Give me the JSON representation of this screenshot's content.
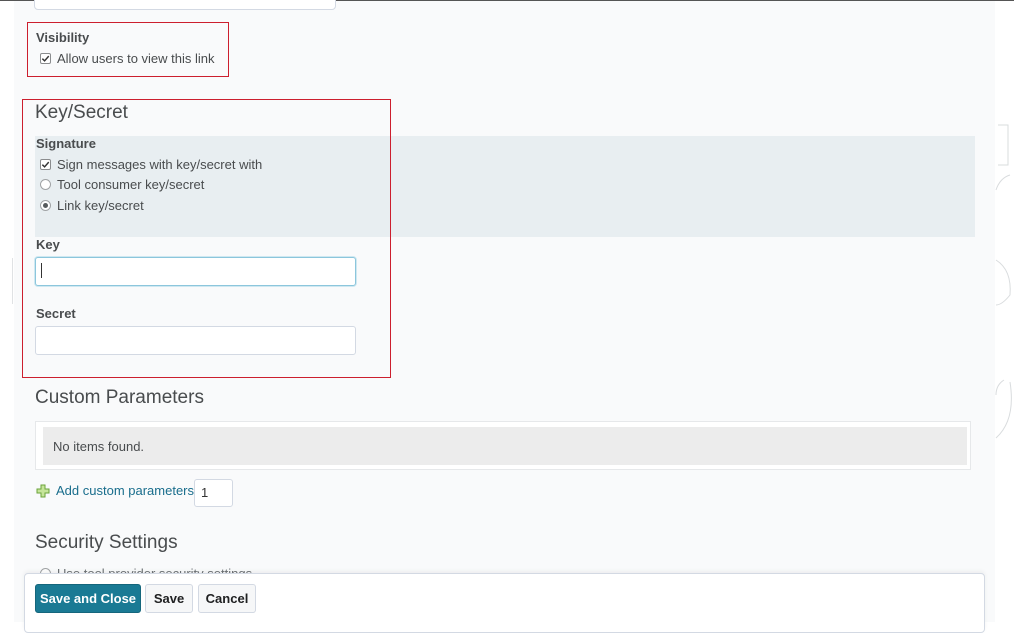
{
  "visibility": {
    "label": "Visibility",
    "checkbox_label": "Allow users to view this link",
    "checked": true
  },
  "key_secret": {
    "title": "Key/Secret",
    "signature": {
      "label": "Signature",
      "sign_checkbox_label": "Sign messages with key/secret with",
      "sign_checked": true,
      "options": [
        {
          "label": "Tool consumer key/secret",
          "selected": false
        },
        {
          "label": "Link key/secret",
          "selected": true
        }
      ]
    },
    "key": {
      "label": "Key",
      "value": ""
    },
    "secret": {
      "label": "Secret",
      "value": ""
    }
  },
  "custom_parameters": {
    "title": "Custom Parameters",
    "empty_text": "No items found.",
    "add_label": "Add custom parameters",
    "add_count": "1"
  },
  "security_settings": {
    "title": "Security Settings",
    "first_option": "Use tool provider security settings"
  },
  "footer": {
    "save_close_label": "Save and Close",
    "save_label": "Save",
    "cancel_label": "Cancel"
  },
  "colors": {
    "accent": "#1a7a94",
    "highlight_box": "#cc1f2e",
    "link": "#196d8c"
  }
}
